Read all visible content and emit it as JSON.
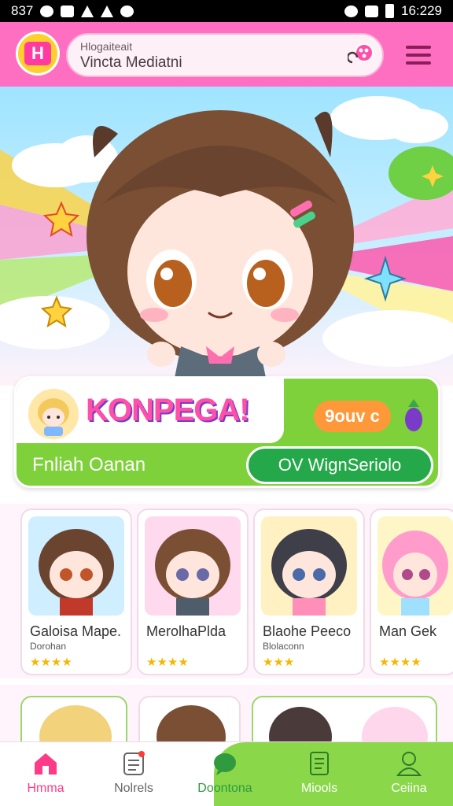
{
  "status_bar": {
    "left_text": "837",
    "time": "16:229"
  },
  "header": {
    "logo_text": "H",
    "search": {
      "line1": "Hlogaiteait",
      "line2": "Vincta Mediatni"
    }
  },
  "banner": {
    "title": "KONPEGA!",
    "price": "9ouv c",
    "subtitle": "Fnliah Oanan",
    "button_label": "OV  WignSeriolo"
  },
  "cards": [
    {
      "name": "Galoisa Mape.",
      "sub": "Dorohan",
      "stars": "★★★★",
      "accent": "#8fd8ff"
    },
    {
      "name": "MerolhaPlda",
      "sub": "",
      "stars": "★★★★",
      "accent": "#ff6fb0"
    },
    {
      "name": "Blaohe Peeco",
      "sub": "Blolaconn",
      "stars": "★★★",
      "accent": "#ffb347"
    },
    {
      "name": "Man Gek",
      "sub": "",
      "stars": "★★★★",
      "accent": "#7fd13b"
    }
  ],
  "nav": [
    {
      "label": "Hmma",
      "icon": "home-icon",
      "color": "#ff3a86"
    },
    {
      "label": "Nolrels",
      "icon": "notes-icon",
      "color": "#666666"
    },
    {
      "label": "Doontona",
      "icon": "chat-icon",
      "color": "#ffffff"
    },
    {
      "label": "Miools",
      "icon": "document-icon",
      "color": "#ffffff"
    },
    {
      "label": "Ceiina",
      "icon": "profile-icon",
      "color": "#ffffff"
    }
  ],
  "colors": {
    "brand_pink": "#ff6fc1",
    "brand_green": "#7fd13b",
    "accent_orange": "#ff9838"
  }
}
